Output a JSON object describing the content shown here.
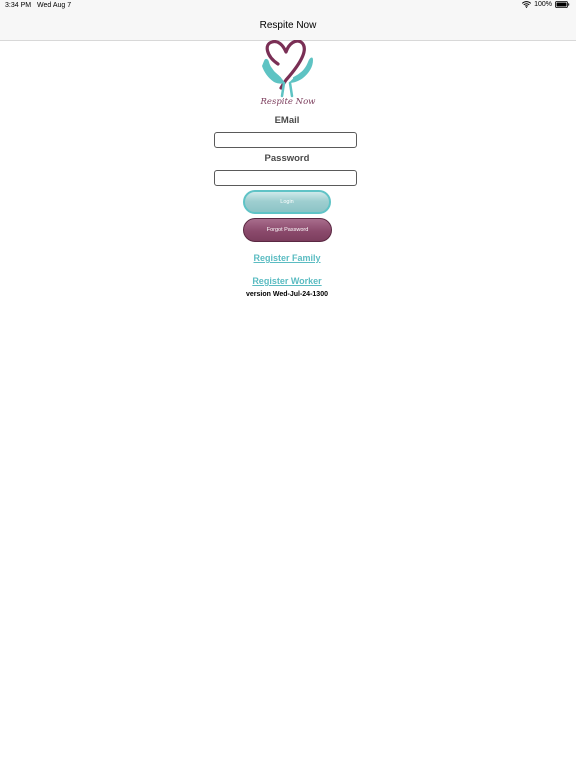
{
  "status_bar": {
    "time": "3:34 PM",
    "date": "Wed Aug 7",
    "battery_percent": "100%",
    "battery_level": 1.0
  },
  "nav": {
    "title": "Respite Now"
  },
  "logo": {
    "text": "Respite Now",
    "colors": {
      "heart": "#7a2f55",
      "hands": "#5ec3c3"
    }
  },
  "form": {
    "email_label": "EMail",
    "email_value": "",
    "password_label": "Password",
    "password_value": ""
  },
  "buttons": {
    "login_label": "Login",
    "forgot_label": "Forgot Password"
  },
  "links": {
    "register_family": "Register Family",
    "register_worker": "Register Worker"
  },
  "version": "version Wed-Jul-24-1300",
  "colors": {
    "accent_teal": "#5bbcc2",
    "accent_plum": "#8b4a6c"
  }
}
